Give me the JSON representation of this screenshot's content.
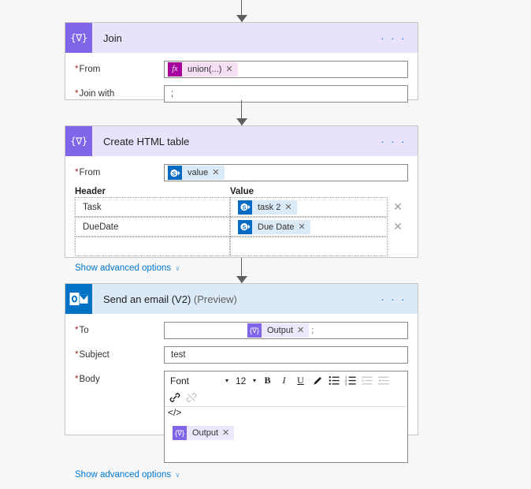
{
  "theme": {
    "canvas_bg": "#f7f7f7",
    "card_border": "#c8c6c4",
    "dataop_accent": "#8165e8",
    "dataop_header_bg": "#e8e3fb",
    "outlook_accent": "#0072c6",
    "outlook_header_bg": "#dceaf7",
    "link_blue": "#0078d4",
    "required_red": "#a4262c",
    "fx_token_icon": "#a4009e",
    "fx_token_bg": "#f6dff5",
    "sharepoint_token_icon": "#036ac4",
    "sharepoint_token_bg": "#dbeaf7",
    "output_token_bg": "#ece7fb"
  },
  "connectors": [
    {
      "name": "arrow-into-join"
    },
    {
      "name": "arrow-join-to-create-html-table"
    },
    {
      "name": "arrow-create-html-table-to-send-email"
    }
  ],
  "cards": {
    "join": {
      "title": "Join",
      "icon": "data-operations-icon",
      "icon_glyph": "{∇}",
      "overflow_label": "· · ·",
      "fields": [
        {
          "label": "From",
          "required": true,
          "token": {
            "icon": "fx-icon",
            "icon_glyph": "fx",
            "label": "union(...)",
            "remove_label": "✕"
          }
        },
        {
          "label": "Join with",
          "required": true,
          "value": ";"
        }
      ]
    },
    "create_html_table": {
      "title": "Create HTML table",
      "icon": "data-operations-icon",
      "icon_glyph": "{∇}",
      "overflow_label": "· · ·",
      "from_field": {
        "label": "From",
        "required": true,
        "token": {
          "icon": "sharepoint-icon",
          "label": "value",
          "remove_label": "✕"
        }
      },
      "table": {
        "columns": [
          "Header",
          "Value"
        ],
        "rows": [
          {
            "header": "Task",
            "value_token": {
              "icon": "sharepoint-icon",
              "label": "task 2",
              "remove_label": "✕"
            },
            "delete_label": "✕"
          },
          {
            "header": "DueDate",
            "value_token": {
              "icon": "sharepoint-icon",
              "label": "Due Date",
              "remove_label": "✕"
            },
            "delete_label": "✕"
          },
          {
            "header": "",
            "value_token": null,
            "delete_label": ""
          }
        ]
      },
      "advanced_label": "Show advanced options",
      "advanced_chevron": "∨"
    },
    "send_email": {
      "title": "Send an email (V2)",
      "title_suffix": "(Preview)",
      "icon": "outlook-icon",
      "overflow_label": "· · ·",
      "to": {
        "label": "To",
        "required": true,
        "token": {
          "icon": "output-icon",
          "icon_glyph": "{∇}",
          "label": "Output",
          "remove_label": "✕"
        },
        "trailing_text": ";"
      },
      "subject": {
        "label": "Subject",
        "required": true,
        "value": "test"
      },
      "body": {
        "label": "Body",
        "required": true,
        "toolbar": {
          "font_name": "Font",
          "font_size": "12",
          "caret": "▾",
          "buttons": [
            {
              "name": "bold-button",
              "glyph": "B",
              "style": "bold",
              "disabled": false
            },
            {
              "name": "italic-button",
              "glyph": "I",
              "style": "ital",
              "disabled": false
            },
            {
              "name": "underline-button",
              "glyph": "U",
              "style": "und",
              "disabled": false
            },
            {
              "name": "text-color-button",
              "glyph": "✎",
              "style": "pen",
              "disabled": false
            },
            {
              "name": "bulleted-list-button",
              "glyph": "≣",
              "style": "list",
              "disabled": false
            },
            {
              "name": "numbered-list-button",
              "glyph": "≣",
              "style": "list",
              "disabled": false
            },
            {
              "name": "decrease-indent-button",
              "glyph": "≣",
              "style": "list",
              "disabled": true
            },
            {
              "name": "increase-indent-button",
              "glyph": "≣",
              "style": "list",
              "disabled": true
            },
            {
              "name": "insert-link-button",
              "glyph": "🔗",
              "style": "link",
              "disabled": false
            },
            {
              "name": "remove-link-button",
              "glyph": "🔗",
              "style": "link",
              "disabled": true
            }
          ],
          "code_view_label": "</>"
        },
        "content_token": {
          "icon": "output-icon",
          "icon_glyph": "{∇}",
          "label": "Output",
          "remove_label": "✕"
        }
      },
      "advanced_label": "Show advanced options",
      "advanced_chevron": "∨"
    }
  }
}
